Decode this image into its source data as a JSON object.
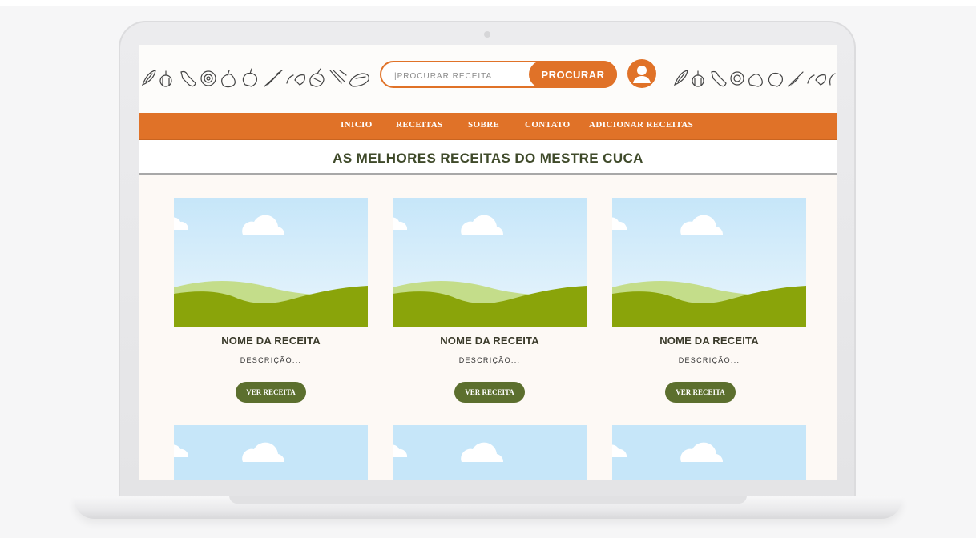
{
  "header": {
    "search_placeholder": "|PROCURAR RECEITA",
    "search_button": "PROCURAR",
    "avatar_icon": "user-icon"
  },
  "nav": {
    "items": [
      "INICIO",
      "RECEITAS",
      "SOBRE",
      "CONTATO",
      "ADICIONAR RECEITAS"
    ]
  },
  "main": {
    "title": "AS MELHORES RECEITAS DO MESTRE CUCA",
    "cards": [
      {
        "name": "NOME DA RECEITA",
        "description": "DESCRIÇÃO...",
        "button": "VER RECEITA"
      },
      {
        "name": "NOME DA RECEITA",
        "description": "DESCRIÇÃO...",
        "button": "VER RECEITA"
      },
      {
        "name": "NOME DA RECEITA",
        "description": "DESCRIÇÃO...",
        "button": "VER RECEITA"
      }
    ]
  },
  "colors": {
    "accent": "#e07228",
    "button_green": "#5c6f2e",
    "sky": "#cde8f8",
    "grass": "#8aa40a",
    "hill_light": "#c4dd8a"
  }
}
